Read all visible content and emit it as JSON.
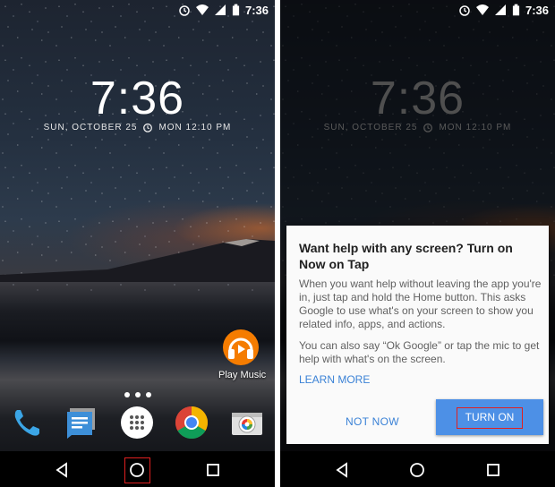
{
  "status_bar": {
    "time": "7:36"
  },
  "lockscreen": {
    "clock": "7:36",
    "date": "SUN, OCTOBER 25",
    "alarm": "MON 12:10 PM"
  },
  "home": {
    "play_music_label": "Play Music",
    "dock_apps": [
      "phone-icon",
      "messenger-icon",
      "app-drawer-icon",
      "chrome-icon",
      "camera-icon"
    ]
  },
  "dialog": {
    "title": "Want help with any screen? Turn on Now on Tap",
    "body1": "When you want help without leaving the app you're in, just tap and hold the Home button. This asks Google to use what's on your screen to show you related info, apps, and actions.",
    "body2": "You can also say “Ok Google” or tap the mic to get help with what's on the screen.",
    "learn_more": "LEARN MORE",
    "not_now": "NOT NOW",
    "turn_on": "TURN ON"
  },
  "colors": {
    "accent_blue": "#4d90e6",
    "highlight_red": "#e02020",
    "play_music_orange": "#f57c00"
  }
}
